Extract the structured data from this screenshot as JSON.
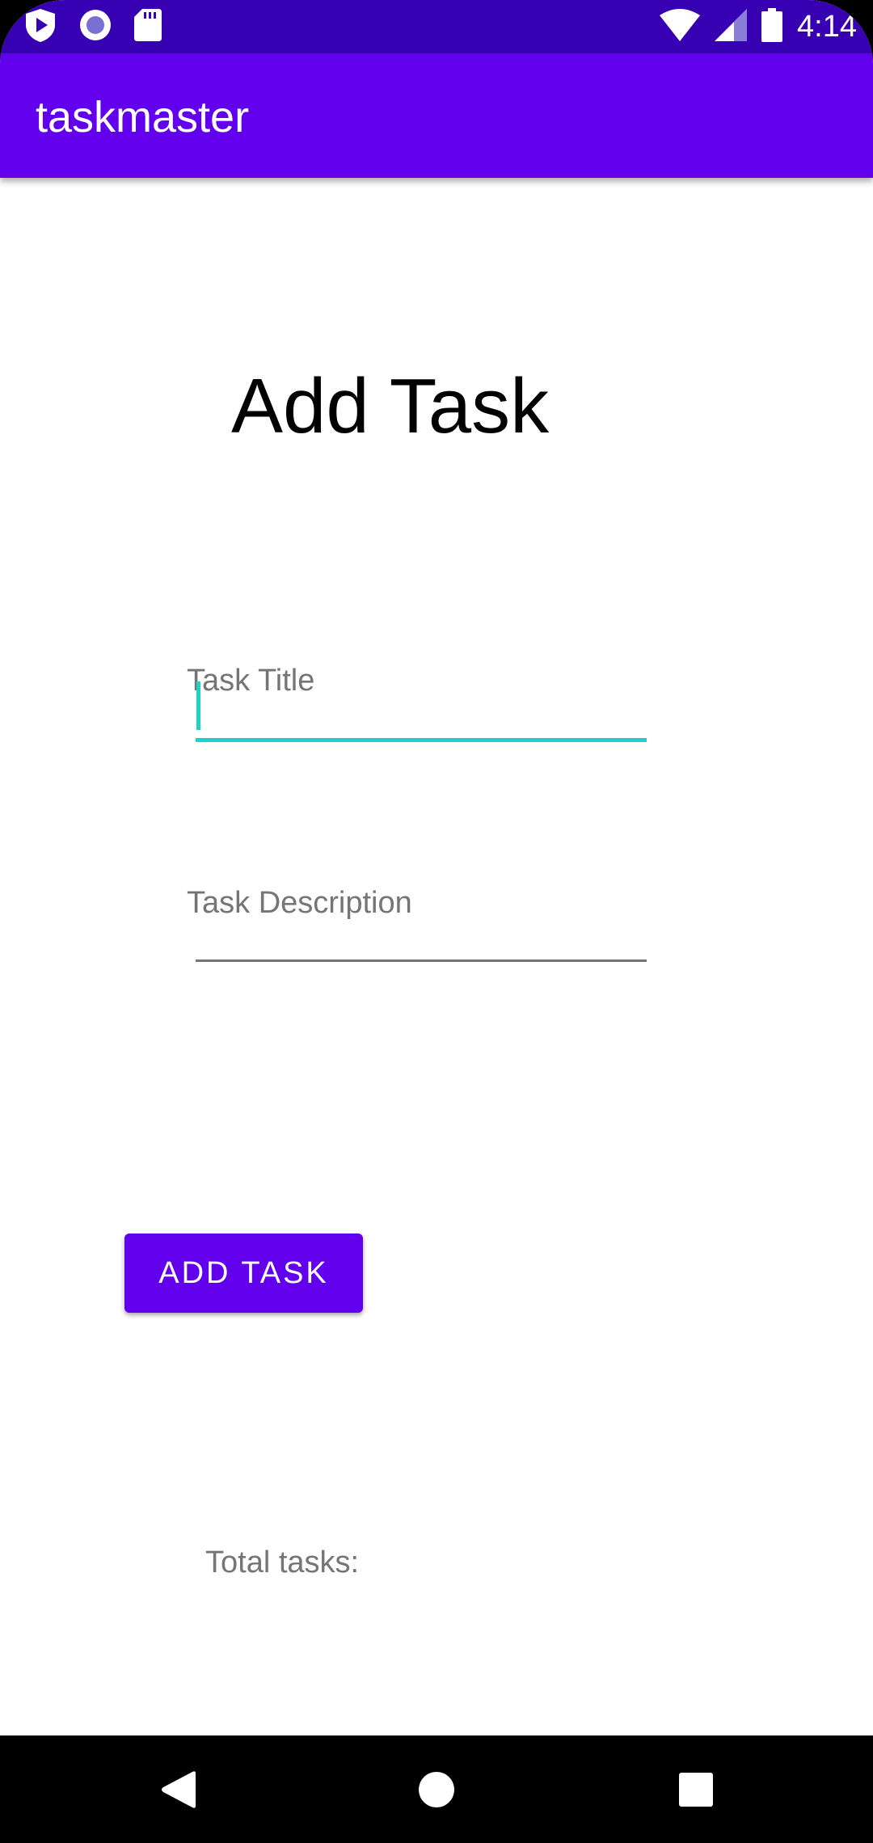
{
  "status_bar": {
    "time": "4:14",
    "left_icons": [
      "play-protect-icon",
      "record-icon",
      "sd-card-icon"
    ],
    "right_icons": [
      "wifi-icon",
      "signal-icon",
      "battery-icon"
    ]
  },
  "app_bar": {
    "title": "taskmaster"
  },
  "page": {
    "heading": "Add Task",
    "title_field": {
      "placeholder": "Task Title",
      "value": ""
    },
    "description_field": {
      "placeholder": "Task Description",
      "value": ""
    },
    "add_button_label": "ADD TASK",
    "total_tasks_label": "Total tasks:"
  },
  "nav_bar": {
    "buttons": [
      "back-icon",
      "home-icon",
      "recents-icon"
    ]
  },
  "colors": {
    "status_bar": "#3700B3",
    "primary": "#6200EE",
    "accent": "#1BD3C6",
    "hint_text": "#757575"
  }
}
